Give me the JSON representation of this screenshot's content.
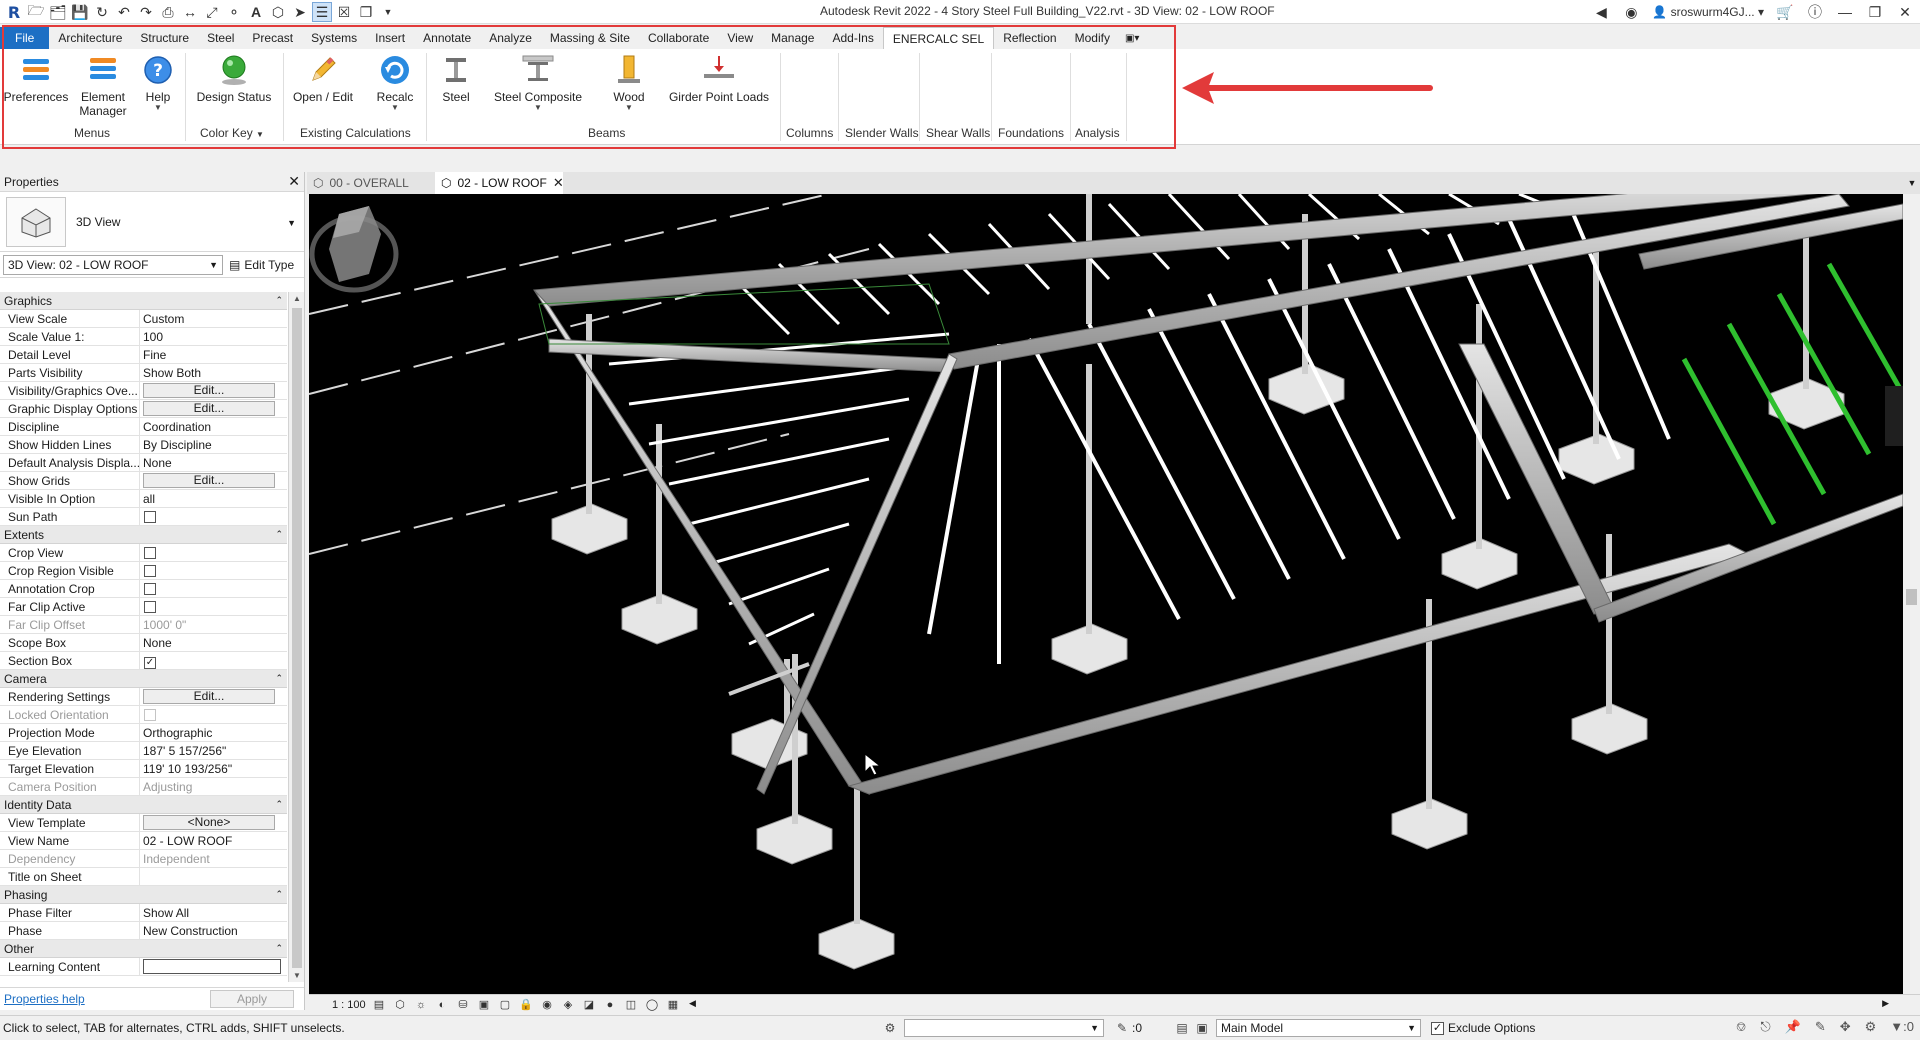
{
  "title": "Autodesk Revit 2022 - 4 Story Steel Full Building_V22.rvt - 3D View: 02 - LOW ROOF",
  "user": {
    "name": "sroswurm4GJ..."
  },
  "ribbon": {
    "tabs": [
      {
        "label": "File"
      },
      {
        "label": "Architecture"
      },
      {
        "label": "Structure"
      },
      {
        "label": "Steel"
      },
      {
        "label": "Precast"
      },
      {
        "label": "Systems"
      },
      {
        "label": "Insert"
      },
      {
        "label": "Annotate"
      },
      {
        "label": "Analyze"
      },
      {
        "label": "Massing & Site"
      },
      {
        "label": "Collaborate"
      },
      {
        "label": "View"
      },
      {
        "label": "Manage"
      },
      {
        "label": "Add-Ins"
      },
      {
        "label": "ENERCALC SEL"
      },
      {
        "label": "Reflection"
      },
      {
        "label": "Modify"
      }
    ],
    "active_tab": "ENERCALC SEL",
    "buttons": {
      "preferences": "Preferences",
      "element_manager_l1": "Element",
      "element_manager_l2": "Manager",
      "help": "Help",
      "design_status": "Design Status",
      "open_edit": "Open / Edit",
      "recalc": "Recalc",
      "steel": "Steel",
      "steel_composite": "Steel Composite",
      "wood": "Wood",
      "girder_point_loads": "Girder Point Loads"
    },
    "panels": {
      "menus": "Menus",
      "color_key": "Color Key",
      "existing_calcs": "Existing Calculations",
      "beams": "Beams",
      "columns": "Columns",
      "slender_walls": "Slender Walls",
      "shear_walls": "Shear Walls",
      "foundations": "Foundations",
      "analysis": "Analysis"
    }
  },
  "properties": {
    "title": "Properties",
    "type_name": "3D View",
    "instance": "3D View: 02 - LOW ROOF",
    "edit_type": "Edit Type",
    "groups": {
      "graphics": "Graphics",
      "extents": "Extents",
      "camera": "Camera",
      "identity": "Identity Data",
      "phasing": "Phasing",
      "other": "Other"
    },
    "rows": {
      "view_scale": {
        "name": "View Scale",
        "value": "Custom"
      },
      "scale_value": {
        "name": "Scale Value    1:",
        "value": "100"
      },
      "detail_level": {
        "name": "Detail Level",
        "value": "Fine"
      },
      "parts_visibility": {
        "name": "Parts Visibility",
        "value": "Show Both"
      },
      "vis_graphics": {
        "name": "Visibility/Graphics Ove...",
        "value": "Edit..."
      },
      "graphic_display": {
        "name": "Graphic Display Options",
        "value": "Edit..."
      },
      "discipline": {
        "name": "Discipline",
        "value": "Coordination"
      },
      "hidden_lines": {
        "name": "Show Hidden Lines",
        "value": "By Discipline"
      },
      "default_analysis": {
        "name": "Default Analysis Displa...",
        "value": "None"
      },
      "show_grids": {
        "name": "Show Grids",
        "value": "Edit..."
      },
      "visible_in_option": {
        "name": "Visible In Option",
        "value": "all"
      },
      "sun_path": {
        "name": "Sun Path",
        "checked": false
      },
      "crop_view": {
        "name": "Crop View",
        "checked": false
      },
      "crop_region_visible": {
        "name": "Crop Region Visible",
        "checked": false
      },
      "annotation_crop": {
        "name": "Annotation Crop",
        "checked": false
      },
      "far_clip_active": {
        "name": "Far Clip Active",
        "checked": false
      },
      "far_clip_offset": {
        "name": "Far Clip Offset",
        "value": "1000'  0\""
      },
      "scope_box": {
        "name": "Scope Box",
        "value": "None"
      },
      "section_box": {
        "name": "Section Box",
        "checked": true,
        "mark": "✓"
      },
      "rendering_settings": {
        "name": "Rendering Settings",
        "value": "Edit..."
      },
      "locked_orientation": {
        "name": "Locked Orientation",
        "checked": false
      },
      "projection_mode": {
        "name": "Projection Mode",
        "value": "Orthographic"
      },
      "eye_elevation": {
        "name": "Eye Elevation",
        "value": "187'  5 157/256\""
      },
      "target_elevation": {
        "name": "Target Elevation",
        "value": "119'  10 193/256\""
      },
      "camera_position": {
        "name": "Camera Position",
        "value": "Adjusting"
      },
      "view_template": {
        "name": "View Template",
        "value": "<None>"
      },
      "view_name": {
        "name": "View Name",
        "value": "02 - LOW ROOF"
      },
      "dependency": {
        "name": "Dependency",
        "value": "Independent"
      },
      "title_on_sheet": {
        "name": "Title on Sheet",
        "value": ""
      },
      "phase_filter": {
        "name": "Phase Filter",
        "value": "Show All"
      },
      "phase": {
        "name": "Phase",
        "value": "New Construction"
      },
      "learning_content": {
        "name": "Learning Content",
        "value": ""
      }
    },
    "help_link": "Properties help",
    "apply": "Apply"
  },
  "view_tabs": [
    {
      "label": "00 - OVERALL",
      "active": false
    },
    {
      "label": "02 - LOW ROOF",
      "active": true
    }
  ],
  "view_control": {
    "scale": "1 : 100"
  },
  "status": {
    "message": "Click to select, TAB for alternates, CTRL adds, SHIFT unselects.",
    "selection_count": ":0",
    "model": "Main Model",
    "exclude_options": "Exclude Options",
    "filter_count": ":0"
  },
  "colors": {
    "file_tab": "#1d6fc4",
    "highlight": "#e23a3a",
    "canvas_bg": "#000000",
    "brace_green": "#2fbf2f"
  }
}
